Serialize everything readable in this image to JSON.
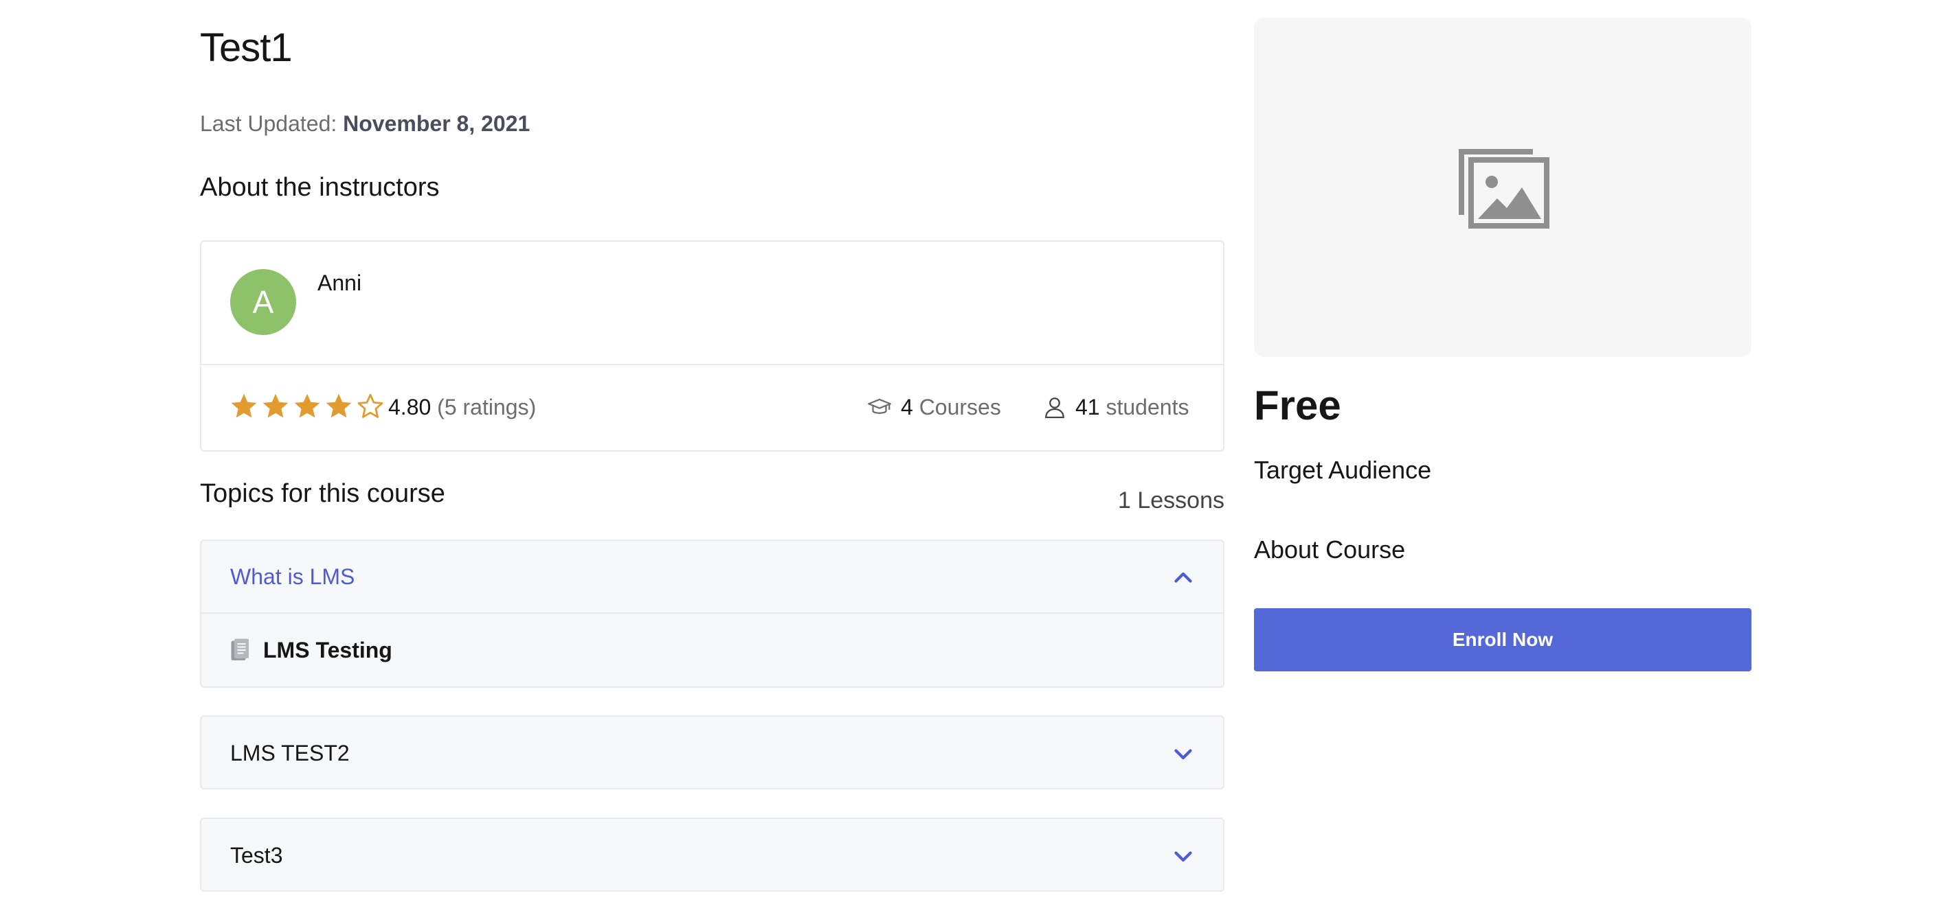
{
  "course": {
    "title": "Test1",
    "last_updated_label": "Last Updated:",
    "last_updated_date": "November 8, 2021"
  },
  "instructors": {
    "heading": "About the instructors",
    "items": [
      {
        "initial": "A",
        "name": "Anni",
        "avatar_color": "#8dc16a",
        "rating_value": "4.80",
        "rating_count": "(5 ratings)",
        "stars_filled": 4,
        "stars_total": 5,
        "courses_num": "4",
        "courses_label": "Courses",
        "students_num": "41",
        "students_label": "students"
      }
    ]
  },
  "topics": {
    "heading": "Topics for this course",
    "lessons_count": "1 Lessons",
    "items": [
      {
        "title": "What is LMS",
        "expanded": true,
        "lessons": [
          {
            "title": "LMS Testing"
          }
        ]
      },
      {
        "title": "LMS TEST2",
        "expanded": false
      },
      {
        "title": "Test3",
        "expanded": false
      }
    ]
  },
  "sidebar": {
    "price": "Free",
    "target_audience_label": "Target Audience",
    "about_course_label": "About Course",
    "enroll_label": "Enroll Now"
  },
  "colors": {
    "accent": "#5568d8",
    "link": "#4f5bd5",
    "star": "#e29b31"
  },
  "icons": [
    "image-placeholder-icon",
    "star-icon",
    "graduation-cap-icon",
    "user-icon",
    "chevron-up-icon",
    "chevron-down-icon",
    "document-icon"
  ]
}
